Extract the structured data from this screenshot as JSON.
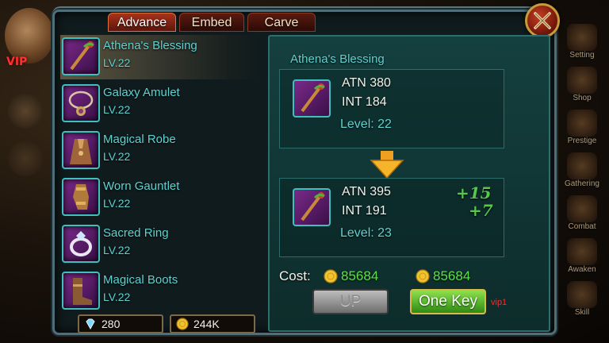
{
  "tabs": [
    {
      "label": "Advance",
      "active": true
    },
    {
      "label": "Embed",
      "active": false
    },
    {
      "label": "Carve",
      "active": false
    }
  ],
  "close_icon": "crossed-swords-close-icon",
  "background_hud": {
    "vip_label": "VIP",
    "right_menu": [
      "Setting",
      "Shop",
      "Prestige",
      "Gathering",
      "Combat",
      "Awaken",
      "Skill"
    ]
  },
  "items": [
    {
      "name": "Athena's Blessing",
      "level": "LV.22",
      "icon": "staff-icon",
      "selected": true
    },
    {
      "name": "Galaxy Amulet",
      "level": "LV.22",
      "icon": "amulet-icon",
      "selected": false
    },
    {
      "name": "Magical Robe",
      "level": "LV.22",
      "icon": "robe-icon",
      "selected": false
    },
    {
      "name": "Worn Gauntlet",
      "level": "LV.22",
      "icon": "gauntlet-icon",
      "selected": false
    },
    {
      "name": "Sacred Ring",
      "level": "LV.22",
      "icon": "ring-icon",
      "selected": false
    },
    {
      "name": "Magical Boots",
      "level": "LV.22",
      "icon": "boots-icon",
      "selected": false
    }
  ],
  "currency": {
    "gems": "280",
    "gold": "244K"
  },
  "detail": {
    "title": "Athena's Blessing",
    "before": {
      "atn": "ATN 380",
      "int": "INT 184",
      "level": "Level: 22"
    },
    "after": {
      "atn": "ATN 395",
      "int": "INT 191",
      "level": "Level: 23",
      "atn_bonus": "+15",
      "int_bonus": "+7"
    }
  },
  "cost": {
    "label": "Cost:",
    "up_cost": "85684",
    "one_key_cost": "85684"
  },
  "buttons": {
    "up": "UP",
    "one_key": "One Key",
    "vip_requirement": "vip1"
  },
  "colors": {
    "accent_teal": "#5fd2d0",
    "bonus_green": "#56c84a",
    "cost_green": "#5ee04a",
    "vip_red": "#ff2a2a"
  }
}
